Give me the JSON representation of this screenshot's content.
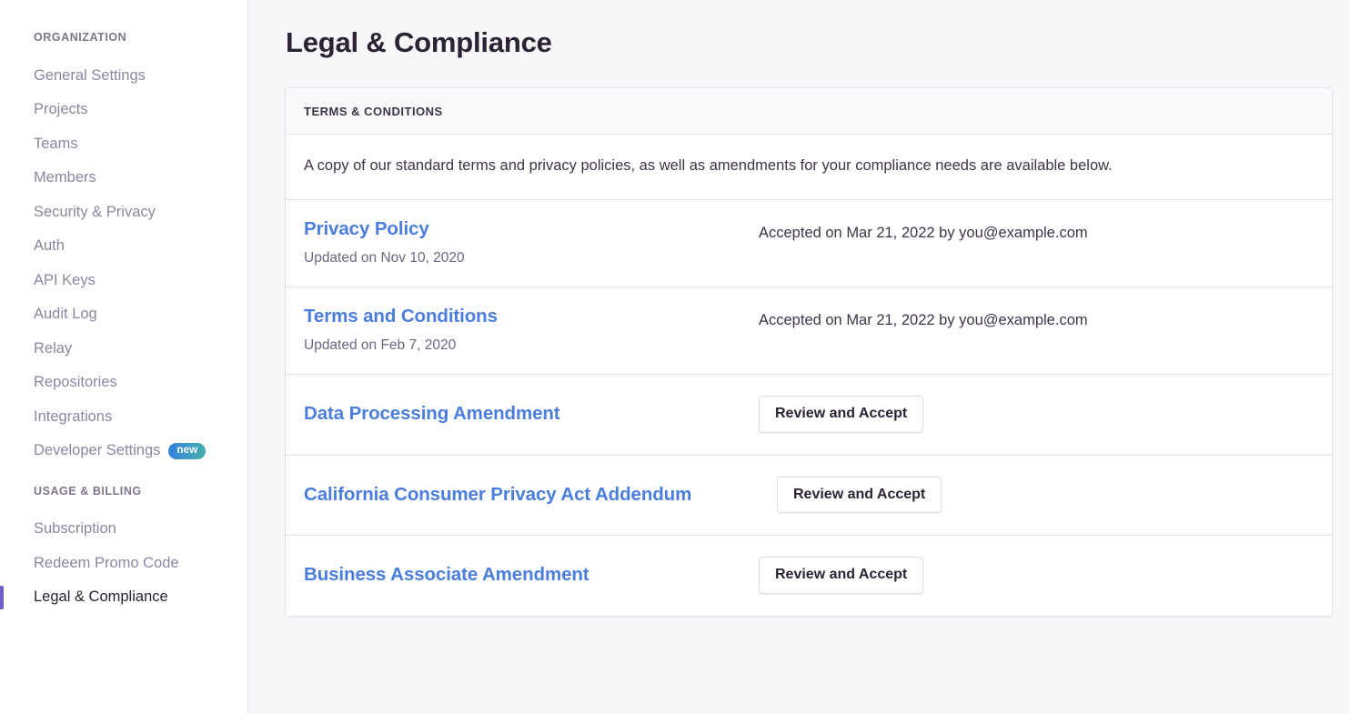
{
  "sidebar": {
    "sections": [
      {
        "heading": "ORGANIZATION",
        "items": [
          {
            "label": "General Settings",
            "active": false
          },
          {
            "label": "Projects",
            "active": false
          },
          {
            "label": "Teams",
            "active": false
          },
          {
            "label": "Members",
            "active": false
          },
          {
            "label": "Security & Privacy",
            "active": false
          },
          {
            "label": "Auth",
            "active": false
          },
          {
            "label": "API Keys",
            "active": false
          },
          {
            "label": "Audit Log",
            "active": false
          },
          {
            "label": "Relay",
            "active": false
          },
          {
            "label": "Repositories",
            "active": false
          },
          {
            "label": "Integrations",
            "active": false
          },
          {
            "label": "Developer Settings",
            "active": false,
            "badge": "new"
          }
        ]
      },
      {
        "heading": "USAGE & BILLING",
        "items": [
          {
            "label": "Subscription",
            "active": false
          },
          {
            "label": "Redeem Promo Code",
            "active": false
          },
          {
            "label": "Legal & Compliance",
            "active": true
          }
        ]
      }
    ]
  },
  "main": {
    "page_title": "Legal & Compliance",
    "card": {
      "header": "TERMS & CONDITIONS",
      "intro": "A copy of our standard terms and privacy policies, as well as amendments for your compliance needs are available below.",
      "rows": [
        {
          "title": "Privacy Policy",
          "updated": "Updated on Nov 10, 2020",
          "status": "Accepted on Mar 21, 2022 by you@example.com",
          "action": null
        },
        {
          "title": "Terms and Conditions",
          "updated": "Updated on Feb 7, 2020",
          "status": "Accepted on Mar 21, 2022 by you@example.com",
          "action": null
        },
        {
          "title": "Data Processing Amendment",
          "updated": null,
          "status": null,
          "action": "Review and Accept"
        },
        {
          "title": "California Consumer Privacy Act Addendum",
          "updated": null,
          "status": null,
          "action": "Review and Accept"
        },
        {
          "title": "Business Associate Amendment",
          "updated": null,
          "status": null,
          "action": "Review and Accept"
        }
      ]
    }
  },
  "colors": {
    "accent_active": "#6c5fc7",
    "link": "#4a7ddc",
    "page_bg": "#f7f7fa",
    "text_primary": "#2b2233",
    "text_muted": "#8d86a0",
    "badge_gradient_start": "#2f7ddb",
    "badge_gradient_end": "#46b0a9"
  }
}
